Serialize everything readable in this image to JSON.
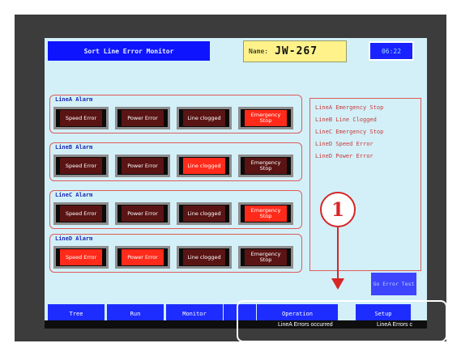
{
  "header": {
    "title": "Sort Line Error Monitor",
    "name_label": "Name:",
    "name_value": "JW-267",
    "time": "06:22"
  },
  "groups": [
    {
      "label": "LineA Alarm",
      "buttons": [
        {
          "label": "Speed Error",
          "state": "off"
        },
        {
          "label": "Power Error",
          "state": "off"
        },
        {
          "label": "Line clogged",
          "state": "off"
        },
        {
          "label": "Emergency Stop",
          "state": "on"
        }
      ]
    },
    {
      "label": "LineB Alarm",
      "buttons": [
        {
          "label": "Speed Error",
          "state": "off"
        },
        {
          "label": "Power Error",
          "state": "off"
        },
        {
          "label": "Line clogged",
          "state": "on"
        },
        {
          "label": "Emergency Stop",
          "state": "off"
        }
      ]
    },
    {
      "label": "LineC Alarm",
      "buttons": [
        {
          "label": "Speed Error",
          "state": "off"
        },
        {
          "label": "Power Error",
          "state": "off"
        },
        {
          "label": "Line clogged",
          "state": "off"
        },
        {
          "label": "Emergency Stop",
          "state": "on"
        }
      ]
    },
    {
      "label": "LineD Alarm",
      "buttons": [
        {
          "label": "Speed Error",
          "state": "on"
        },
        {
          "label": "Power Error",
          "state": "on"
        },
        {
          "label": "Line clogged",
          "state": "off"
        },
        {
          "label": "Emergency Stop",
          "state": "off"
        }
      ]
    }
  ],
  "alarm_list": [
    "LineA Emergency Stop",
    "LineB Line Clogged",
    "LineC Emergency Stop",
    "LineD Speed Error",
    "LineD Power Error"
  ],
  "error_test_button": "Go Error Test",
  "nav_buttons": [
    "Tree",
    "Run",
    "Monitor",
    "Operation",
    "Setup"
  ],
  "status_bar": {
    "messages": [
      "LineA Errors occurred",
      "LineA Errors c"
    ]
  },
  "callout": {
    "number": "1"
  },
  "colors": {
    "alarm_on": "#ff2a1a",
    "alarm_off": "#5a1414",
    "screen_bg": "#d3f0f8",
    "header_blue": "#0f14ff",
    "callout_red": "#d82525"
  }
}
